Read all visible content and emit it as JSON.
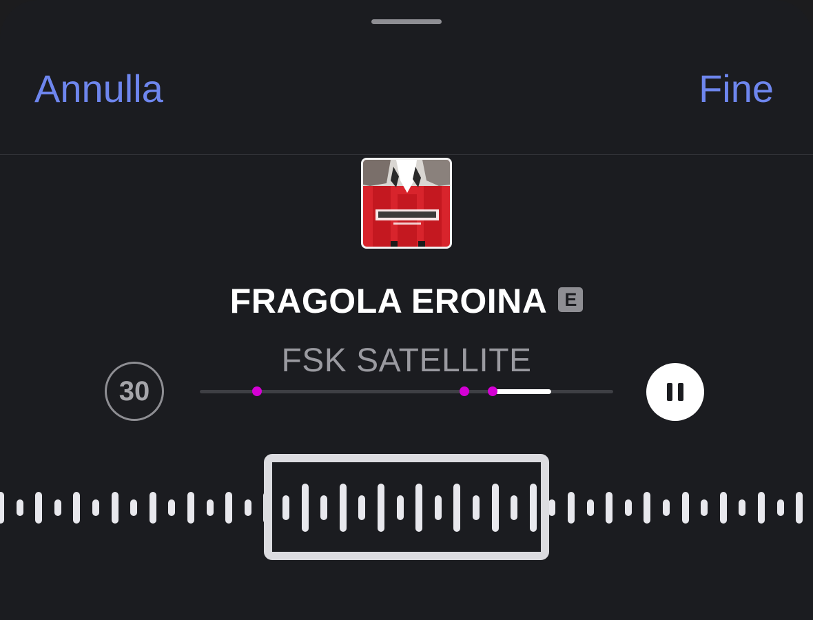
{
  "nav": {
    "cancel_label": "Annulla",
    "done_label": "Fine"
  },
  "song": {
    "title": "FRAGOLA EROINA",
    "explicit_badge": "E",
    "artist": "FSK SATELLITE",
    "artwork_icon": "album-artwork"
  },
  "player": {
    "skip_label": "30",
    "skip_icon": "skip-30-icon",
    "pause_icon": "pause-icon",
    "progress_start_fraction": 0.715,
    "progress_end_fraction": 0.85
  },
  "colors": {
    "accent": "#6e86ee",
    "marker": "#d400d4",
    "background": "#1b1c20"
  }
}
